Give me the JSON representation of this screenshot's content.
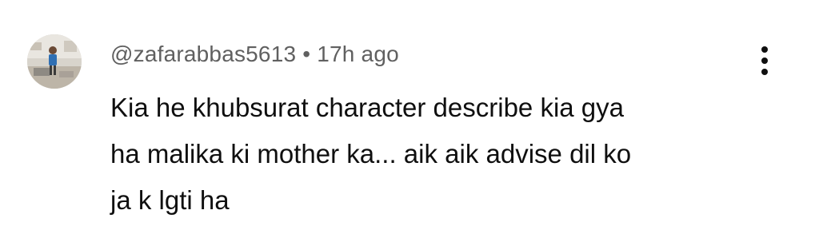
{
  "comment": {
    "author": "@zafarabbas5613",
    "separator": "•",
    "time": "17h ago",
    "text": "Kia he khubsurat character describe kia gya\nha malika ki mother ka... aik aik advise dil ko\nja k lgti ha",
    "avatar_icon": "user-avatar-photo",
    "menu_icon": "more-vertical-icon"
  }
}
